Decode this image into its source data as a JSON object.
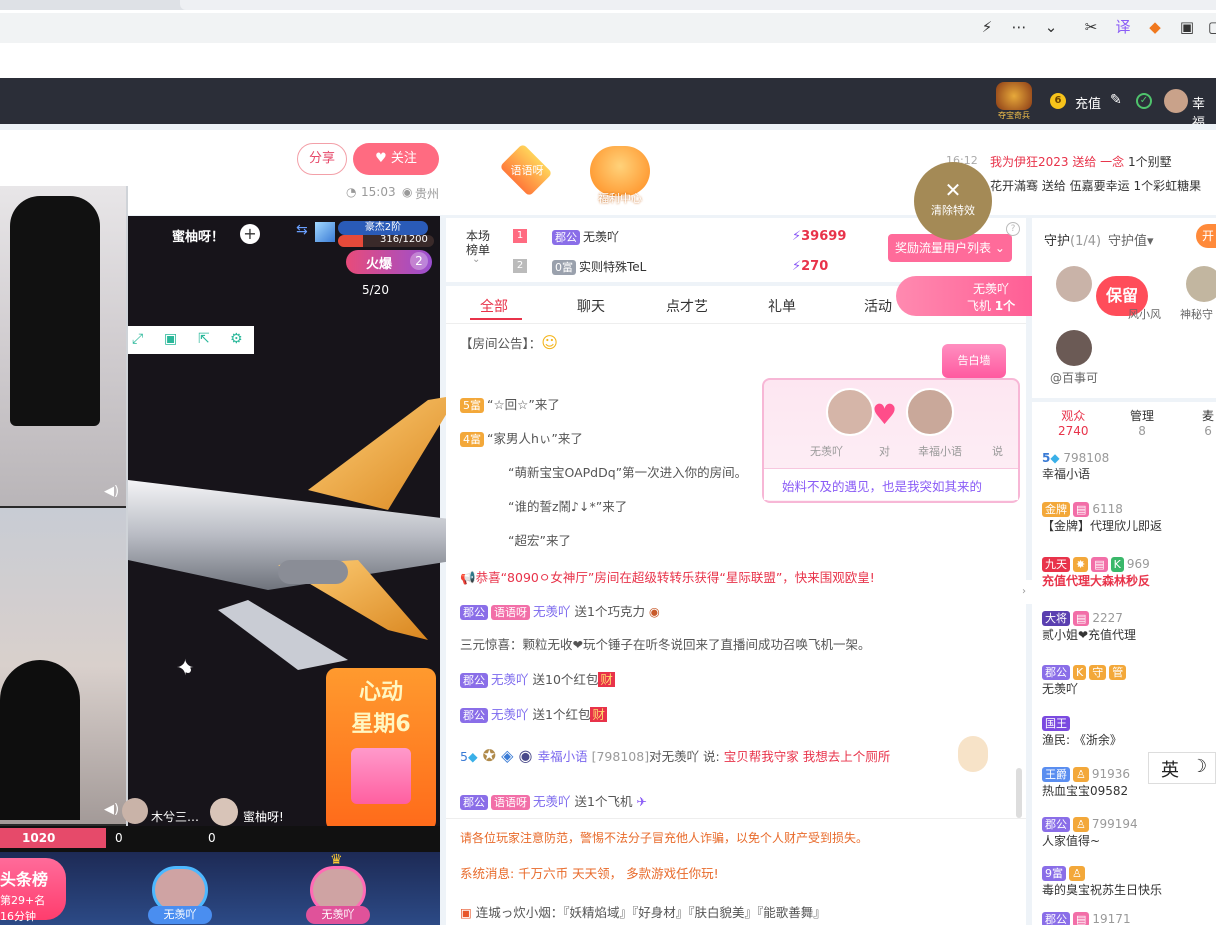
{
  "browser": {
    "toolbar_icons": [
      "lightning-icon",
      "more-icon",
      "chevron-down-icon",
      "scissors-icon",
      "translate-icon",
      "gamepad-icon",
      "shield-icon",
      "window-icon"
    ]
  },
  "topnav": {
    "recharge_label": "充值",
    "user_label": "幸福",
    "coin_count": "6",
    "treasure_label": "夺宝奇兵"
  },
  "info": {
    "share_label": "分享",
    "follow_label": "关注",
    "time": "15:03",
    "location": "贵州",
    "activity_badge": "语语呀",
    "welfare_label": "福利中心",
    "ticker": [
      {
        "time": "16:12",
        "text": "我为伊狂2023 送给 一念",
        "tail": "1个别墅"
      },
      {
        "time": "",
        "text": "花开滿骞 送给 伍嘉要幸运",
        "tail": "1个彩虹糖果"
      }
    ]
  },
  "video": {
    "streamer_name": "蜜柚呀！",
    "level_label": "豪杰2阶",
    "exp": "316/1200",
    "hot_label": "火爆",
    "hot_rank": "2",
    "page_indicator": "5/20",
    "gift_title_1": "心动",
    "gift_title_2": "星期6",
    "bottom_score_1": "1020",
    "bottom_score_2": "0",
    "bottom_score_3": "0",
    "guest_1": "木兮三…",
    "guest_2": "蜜柚呀!",
    "rank_banner": "头条榜",
    "rank_sub1": "第29+名",
    "rank_sub2": "16分钟",
    "host_1": "无羡吖",
    "host_2": "无羡吖"
  },
  "rank": {
    "title1": "本场",
    "title2": "榜单",
    "rows": [
      {
        "pos": "1",
        "badge": "郡公",
        "name": "无羡吖",
        "value": "39699"
      },
      {
        "pos": "2",
        "badge": "0富",
        "name": "实则特殊TeL",
        "value": "270"
      }
    ],
    "reward_button": "奖励流量用户列表"
  },
  "tabs": [
    "全部",
    "聊天",
    "点才艺",
    "礼单",
    "活动"
  ],
  "chat": {
    "announcement": "【房间公告】：",
    "messages": [
      {
        "badge": "5富",
        "text": "“☆回☆”来了"
      },
      {
        "badge": "4富",
        "text": "“家男人hぃ”来了"
      },
      {
        "badge": "",
        "text": "“萌新宝宝OAPdDq”第一次进入你的房间。"
      },
      {
        "badge": "",
        "text": "“谁的誓z鬧♪↓*”来了"
      },
      {
        "badge": "",
        "text": "“超宏”来了"
      }
    ],
    "system_1": "恭喜“8090ㅇ女神厅”房间在超级转转乐获得“星际联盟”，快来围观欧皇!",
    "gift_1_user": "无羡吖",
    "gift_1_text": "送1个巧克力",
    "gift_1_badge": "郡公",
    "gift_1_badge2": "语语呀",
    "game_msg": "三元惊喜：颗粒无收❤玩个锤子在听冬说回来了直播间成功召唤飞机一架。",
    "redpack_1_user": "无羡吖",
    "redpack_1_text": "送10个红包",
    "redpack_2_user": "无羡吖",
    "redpack_2_text": "送1个红包",
    "redpack_tag": "财",
    "say_user": "幸福小语",
    "say_id": "[798108]",
    "say_mid": "对无羡吖 说:",
    "say_text": "宝贝帮我守家 我想去上个厕所",
    "say_level": "5",
    "gift_2_user": "无羡吖",
    "gift_2_text": "送1个飞机",
    "notice_1": "请各位玩家注意防范，警惕不法分子冒充他人诈骗，以免个人财产受到损失。",
    "notice_2": "系统消息: 千万六币 天天领， 多款游戏任你玩!",
    "notice_3": "连城っ炊小烟：『妖精焰域』『好身材』『肤白貌美』『能歌善舞』"
  },
  "popup": {
    "tag": "告白墙",
    "left_name": "无羡吖",
    "mid": "对",
    "right_name": "幸福小语",
    "verb": "说",
    "message": "始料不及的遇见，也是我突如其来的"
  },
  "clear_effect": "清除特效",
  "plane_msg": {
    "user": "无羡吖",
    "text": "飞机",
    "count": "1个"
  },
  "guard": {
    "title": "守护",
    "count": "(1/4)",
    "sort_label": "守护值",
    "open_label": "开",
    "keep_label": "保留",
    "members": [
      "@百事可",
      "风小风",
      "神秘守"
    ]
  },
  "audience": {
    "tab_audience": "观众",
    "audience_count": "2740",
    "tab_manage": "管理",
    "manage_count": "8",
    "tab_third": "麦",
    "third_count": "6",
    "items": [
      {
        "badge": "5",
        "id": "798108",
        "name": "幸福小语"
      },
      {
        "badge": "金牌",
        "id": "6118",
        "name": "【金牌】代理欣儿即返"
      },
      {
        "badge": "九天",
        "id": "969",
        "name": "充值代理大森林秒反"
      },
      {
        "badge": "大将",
        "id": "2227",
        "name": "贰小姐❤充值代理"
      },
      {
        "badge": "郡公",
        "id": "",
        "name": "无羡吖"
      },
      {
        "badge": "国王",
        "id": "",
        "name": "渔民: 《浙余》"
      },
      {
        "badge": "王爵",
        "id": "91936",
        "name": "热血宝宝09582"
      },
      {
        "badge": "郡公",
        "id": "799194",
        "name": "人家值得~"
      },
      {
        "badge": "9富",
        "id": "",
        "name": "毒的臭宝祝苏生日快乐"
      },
      {
        "badge": "郡公",
        "id": "19171",
        "name": ""
      }
    ]
  },
  "ime": {
    "lang": "英",
    "mode": "☽"
  }
}
